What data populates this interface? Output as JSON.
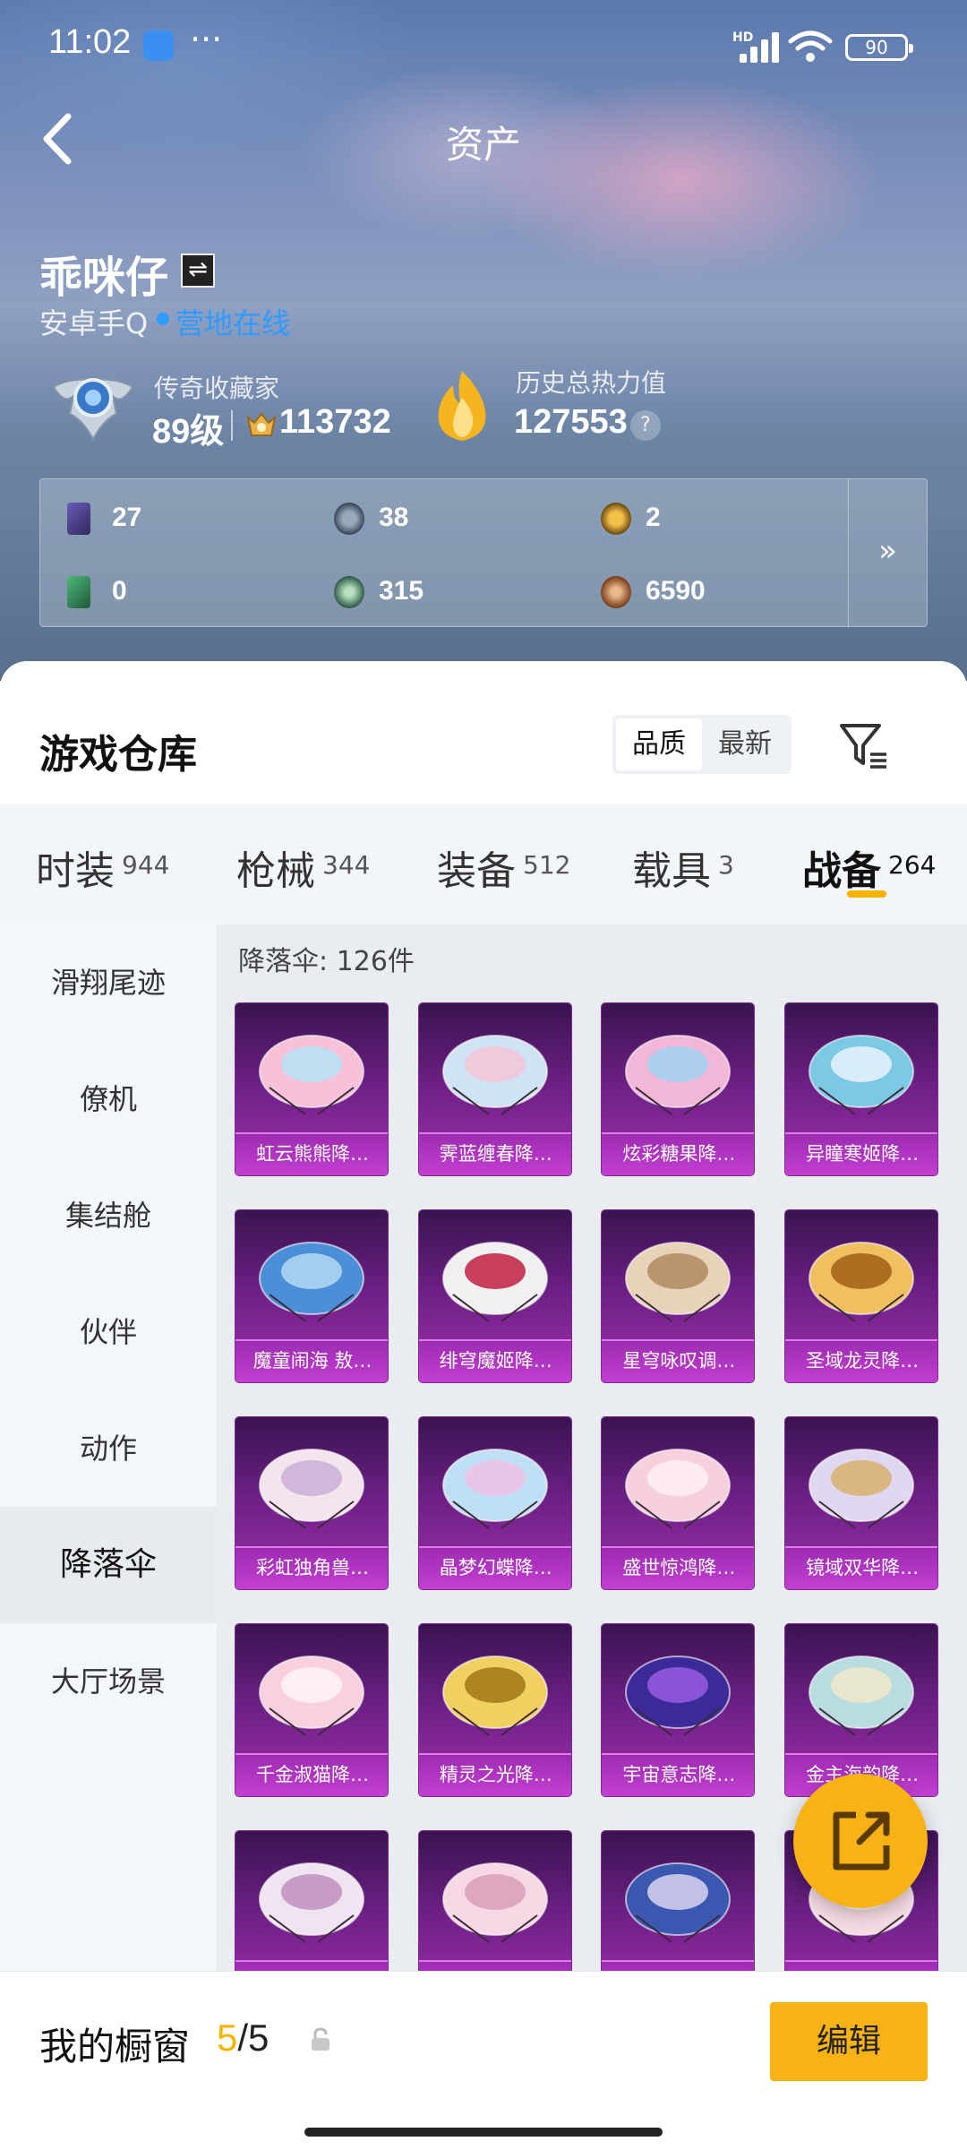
{
  "status_bar": {
    "time": "11:02",
    "dots": "···",
    "hd": "HD",
    "battery": "90"
  },
  "header": {
    "title": "资产",
    "back_icon": "chevron-left-icon"
  },
  "profile": {
    "username": "乖咪仔",
    "swap_icon": "⇌",
    "platform": "安卓手Q",
    "online_status": "营地在线",
    "online_color": "#2f9bff",
    "rank_title": "传奇收藏家",
    "level": "89级",
    "points": "113732",
    "heat_title": "历史总热力值",
    "heat_value": "127553",
    "help": "?"
  },
  "stats": [
    {
      "icon": "card-icon",
      "value": "27"
    },
    {
      "icon": "emblem-grey-icon",
      "value": "38"
    },
    {
      "icon": "emblem-gold-icon",
      "value": "2"
    },
    {
      "icon": "card-green-icon",
      "value": "0"
    },
    {
      "icon": "orb-green-icon",
      "value": "315"
    },
    {
      "icon": "orb-bronze-icon",
      "value": "6590"
    }
  ],
  "stats_more": "»",
  "warehouse": {
    "title": "游戏仓库",
    "sort_options": [
      "品质",
      "最新"
    ],
    "active_sort": "品质"
  },
  "categories": [
    {
      "name": "时装",
      "count": "944"
    },
    {
      "name": "枪械",
      "count": "344"
    },
    {
      "name": "装备",
      "count": "512"
    },
    {
      "name": "载具",
      "count": "3"
    },
    {
      "name": "战备",
      "count": "264"
    }
  ],
  "active_category": "战备",
  "accent_color": "#f5b400",
  "side_nav": [
    "滑翔尾迹",
    "僚机",
    "集结舱",
    "伙伴",
    "动作",
    "降落伞",
    "大厅场景"
  ],
  "active_side": "降落伞",
  "grid": {
    "count_label": "降落伞: 126件",
    "items": [
      "虹云熊熊降…",
      "霁蓝缠春降…",
      "炫彩糖果降…",
      "异瞳寒姬降…",
      "魔童闹海 敖…",
      "绯穹魔姬降…",
      "星穹咏叹调…",
      "圣域龙灵降…",
      "彩虹独角兽…",
      "晶梦幻蝶降…",
      "盛世惊鸿降…",
      "镜域双华降…",
      "千金淑猫降…",
      "精灵之光降…",
      "宇宙意志降…",
      "金主海韵降…",
      "",
      "",
      "",
      ""
    ]
  },
  "fab_icon": "share-icon",
  "bottom": {
    "window_label": "我的橱窗",
    "current": "5",
    "slash": "/",
    "total": "5",
    "edit_label": "编辑"
  }
}
